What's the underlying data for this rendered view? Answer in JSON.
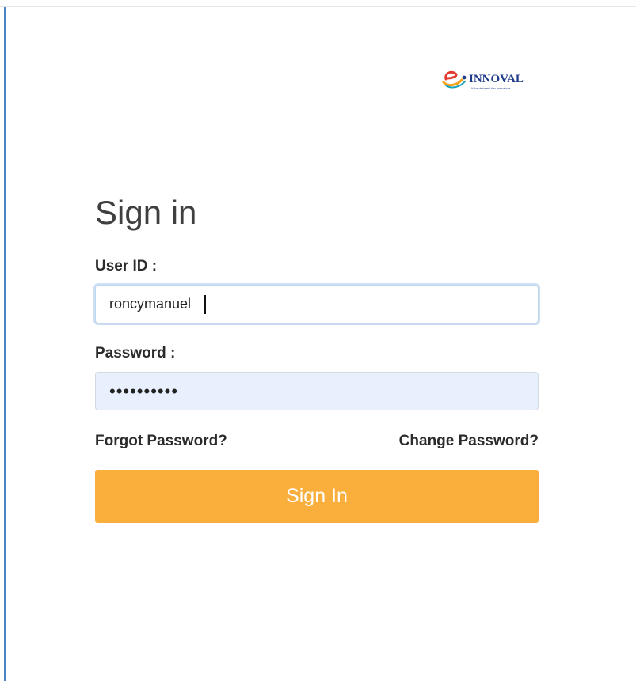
{
  "brand": {
    "logo_text": "INNOVAL",
    "tagline": "Value delivered thru innovations",
    "colors": {
      "blue": "#1e3c8a",
      "red": "#e23a2e",
      "orange": "#f7a21b",
      "teal": "#1aa3b8"
    }
  },
  "form": {
    "title": "Sign in",
    "user_label": "User ID :",
    "user_value": "roncymanuel",
    "password_label": "Password :",
    "password_value": "••••••••••",
    "forgot_link": "Forgot Password?",
    "change_link": "Change Password?",
    "submit_label": "Sign In"
  },
  "colors": {
    "accent": "#faae3b",
    "input_autofill_bg": "#e8f0fe",
    "left_rule": "#4a86c5"
  }
}
